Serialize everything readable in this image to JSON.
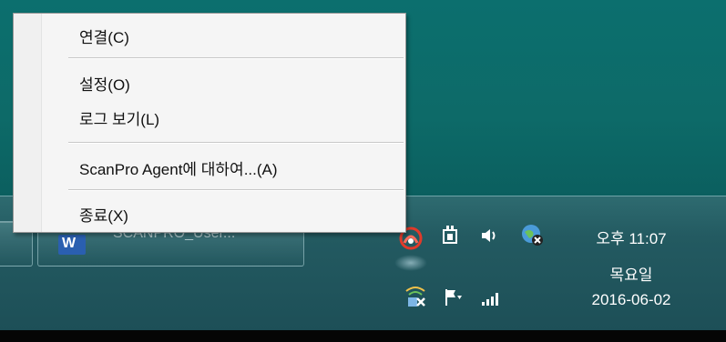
{
  "menu": {
    "items": [
      {
        "label": "연결(C)"
      },
      {
        "label": "설정(O)"
      },
      {
        "label": "로그 보기(L)"
      },
      {
        "label": "ScanPro Agent에 대하여...(A)"
      },
      {
        "label": "종료(X)"
      }
    ]
  },
  "taskbar": {
    "word_button_label": "SCANPRO_User..."
  },
  "tray": {
    "icons": [
      "scanpro-agent-icon",
      "power-plug-icon",
      "volume-icon",
      "network-globe-icon",
      "wifi-disconnected-icon",
      "flag-icon",
      "signal-bars-icon"
    ]
  },
  "clock": {
    "time": "오후 11:07",
    "day": "목요일",
    "date": "2016-06-02"
  },
  "colors": {
    "desktop": "#0c6f6e",
    "taskbar": "#235a61",
    "menu_bg": "#f5f5f5"
  }
}
